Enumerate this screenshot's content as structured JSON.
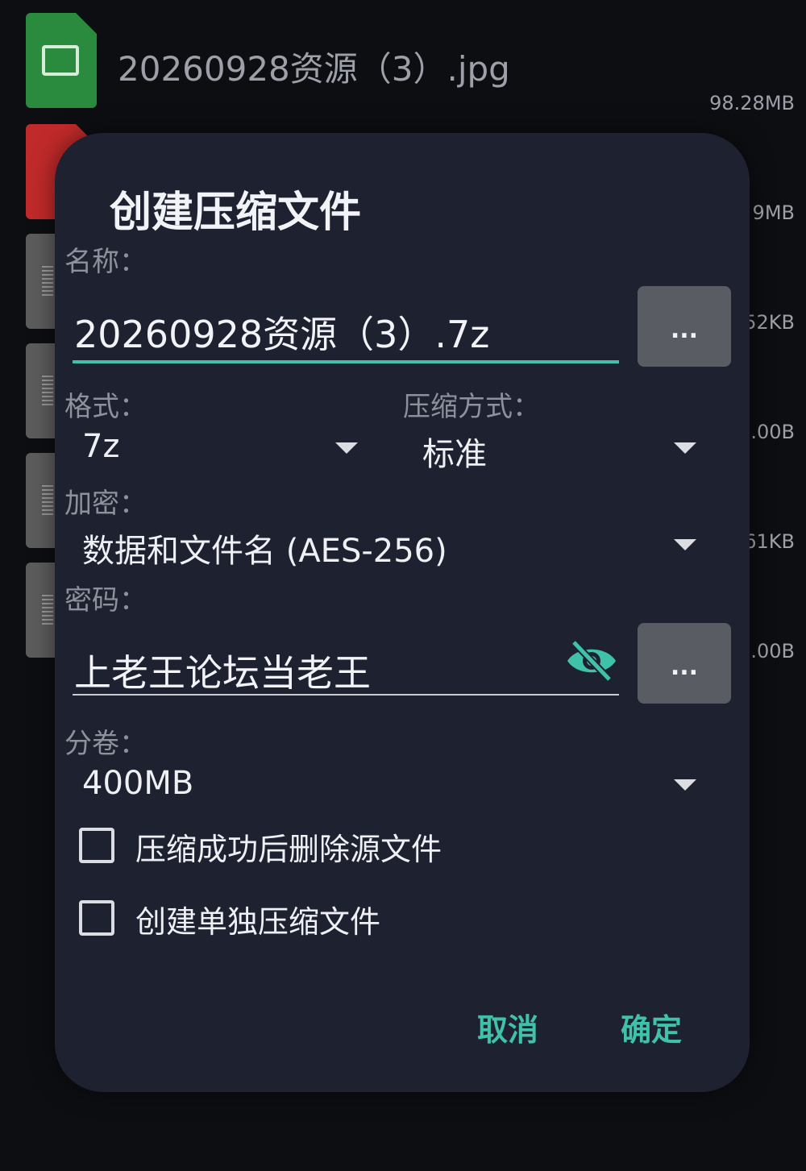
{
  "background": {
    "file_name": "20260928资源（3）.jpg",
    "sizes": [
      "98.28MB",
      "9MB",
      "52KB",
      ".00B",
      "61KB",
      ".00B"
    ]
  },
  "dialog": {
    "title": "创建压缩文件",
    "name_label": "名称：",
    "name_value": "20260928资源（3）.7z",
    "more_button": "...",
    "format_label": "格式：",
    "format_value": "7z",
    "method_label": "压缩方式：",
    "method_value": "标准",
    "encrypt_label": "加密：",
    "encrypt_value": "数据和文件名 (AES-256)",
    "password_label": "密码：",
    "password_value": "上老王论坛当老王",
    "volume_label": "分卷：",
    "volume_value": "400MB",
    "delete_after_label": "压缩成功后删除源文件",
    "delete_after_checked": false,
    "separate_label": "创建单独压缩文件",
    "separate_checked": false,
    "cancel": "取消",
    "ok": "确定"
  },
  "colors": {
    "accent": "#3fc1aa",
    "dialog_bg": "#1e2130"
  },
  "icons": [
    "image-file-icon",
    "pdf-file-icon",
    "doc-file-icon",
    "eye-off-icon",
    "dropdown-caret-icon",
    "checkbox-icon"
  ]
}
